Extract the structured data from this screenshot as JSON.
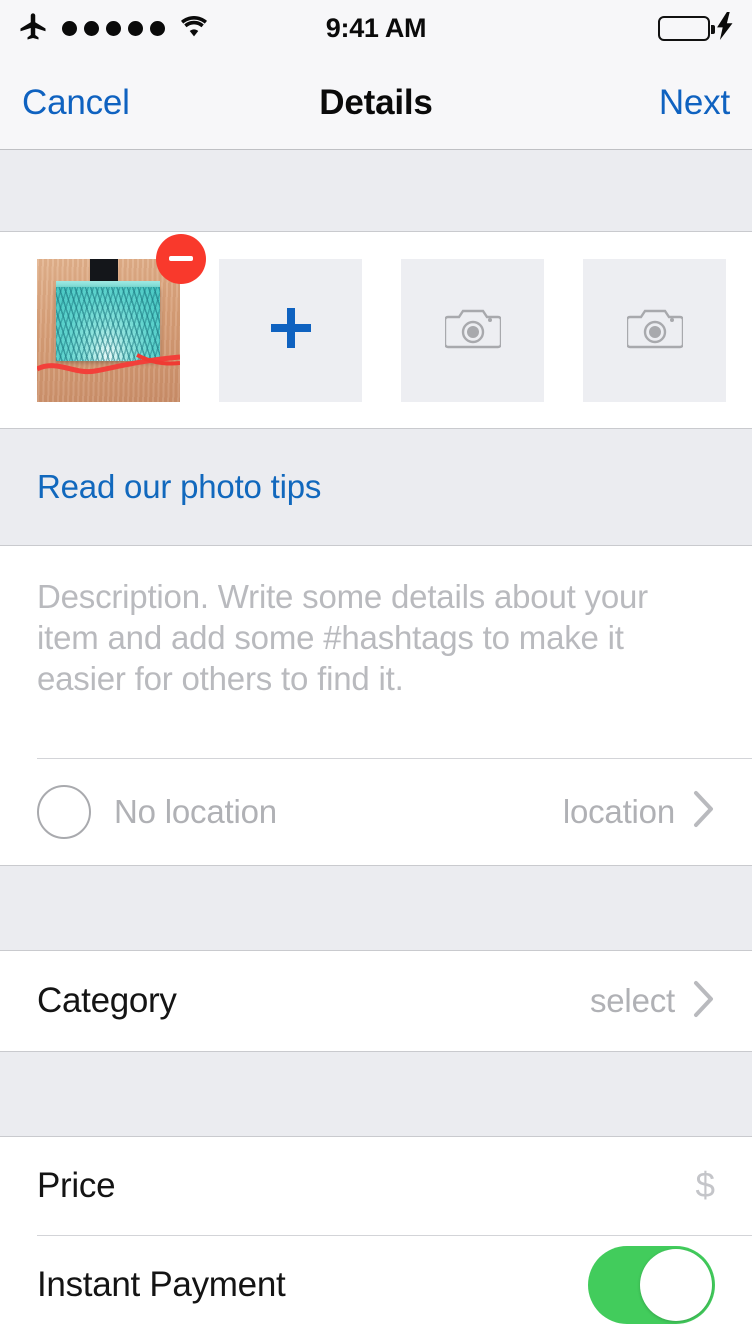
{
  "status_bar": {
    "airplane_icon": "airplane-icon",
    "signal_dots": 5,
    "wifi_icon": "wifi-icon",
    "time": "9:41 AM",
    "battery_icon": "battery-full-icon",
    "battery_color": "#4CD964",
    "charging_icon": "lightning-bolt-icon"
  },
  "nav_bar": {
    "cancel_label": "Cancel",
    "title": "Details",
    "next_label": "Next",
    "tint_color": "#0f62c0"
  },
  "photos": {
    "thumbnails": [
      {
        "type": "photo",
        "alt": "teal woven box on wooden surface",
        "delete_badge": "remove-icon"
      },
      {
        "type": "add",
        "icon": "plus-icon"
      },
      {
        "type": "empty",
        "icon": "camera-icon"
      },
      {
        "type": "empty",
        "icon": "camera-icon"
      }
    ],
    "tips_link": "Read our photo tips",
    "tips_color": "#1168bd"
  },
  "description": {
    "placeholder": "Description. Write some details about your item and add some #hashtags to make it easier for others to find it.",
    "value": ""
  },
  "location": {
    "icon": "circle-outline-icon",
    "label": "No location",
    "value": "location",
    "chevron": "chevron-right-icon"
  },
  "category": {
    "label": "Category",
    "value": "select",
    "chevron": "chevron-right-icon"
  },
  "price": {
    "label": "Price",
    "currency": "$",
    "value": ""
  },
  "instant_payment": {
    "label": "Instant Payment",
    "toggle_on": true,
    "toggle_color": "#42cc5c"
  },
  "colors": {
    "accent": "#0f62c0",
    "danger": "#f9392c",
    "success": "#42cc5c",
    "section_bg": "#ebecf0",
    "placeholder_text": "#b0b1b5"
  }
}
